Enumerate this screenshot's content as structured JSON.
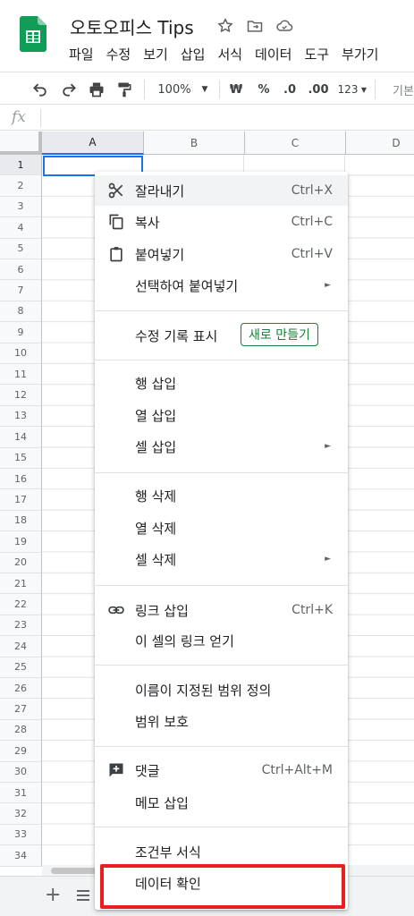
{
  "app": {
    "doc_title": "오토오피스 Tips",
    "menu": [
      "파일",
      "수정",
      "보기",
      "삽입",
      "서식",
      "데이터",
      "도구",
      "부가기"
    ]
  },
  "toolbar": {
    "zoom": "100%",
    "currency": "₩",
    "percent": "%",
    "dec_less": ".0",
    "dec_more": ".00",
    "format_123": "123",
    "font_partial": "기본"
  },
  "formula_bar": {
    "fx": "fx"
  },
  "grid": {
    "columns": [
      "A",
      "B",
      "C",
      "D"
    ],
    "rows": [
      "1",
      "2",
      "3",
      "4",
      "5",
      "6",
      "7",
      "8",
      "9",
      "10",
      "11",
      "12",
      "13",
      "14",
      "15",
      "16",
      "17",
      "18",
      "19",
      "20",
      "21",
      "22",
      "23",
      "24",
      "25",
      "26",
      "27",
      "28",
      "29",
      "30",
      "31",
      "32",
      "33",
      "34"
    ]
  },
  "context_menu": {
    "cut": {
      "label": "잘라내기",
      "shortcut": "Ctrl+X",
      "icon": "scissors-icon"
    },
    "copy": {
      "label": "복사",
      "shortcut": "Ctrl+C",
      "icon": "copy-icon"
    },
    "paste": {
      "label": "붙여넣기",
      "shortcut": "Ctrl+V",
      "icon": "clipboard-icon"
    },
    "paste_special": {
      "label": "선택하여 붙여넣기"
    },
    "edit_history": {
      "label": "수정 기록 표시",
      "badge": "새로 만들기"
    },
    "insert_row": {
      "label": "행 삽입"
    },
    "insert_col": {
      "label": "열 삽입"
    },
    "insert_cells": {
      "label": "셀 삽입"
    },
    "delete_row": {
      "label": "행 삭제"
    },
    "delete_col": {
      "label": "열 삭제"
    },
    "delete_cells": {
      "label": "셀 삭제"
    },
    "insert_link": {
      "label": "링크 삽입",
      "shortcut": "Ctrl+K",
      "icon": "link-icon"
    },
    "get_link": {
      "label": "이 셀의 링크 얻기"
    },
    "named_range": {
      "label": "이름이 지정된 범위 정의"
    },
    "protect_range": {
      "label": "범위 보호"
    },
    "comment": {
      "label": "댓글",
      "shortcut": "Ctrl+Alt+M",
      "icon": "add-comment-icon"
    },
    "insert_note": {
      "label": "메모 삽입"
    },
    "conditional_format": {
      "label": "조건부 서식"
    },
    "data_validation": {
      "label": "데이터 확인"
    }
  },
  "colors": {
    "accent": "#1a73e8",
    "highlight": "#ee1c1c",
    "sheets_green": "#0f9d58",
    "badge_green": "#188038"
  }
}
